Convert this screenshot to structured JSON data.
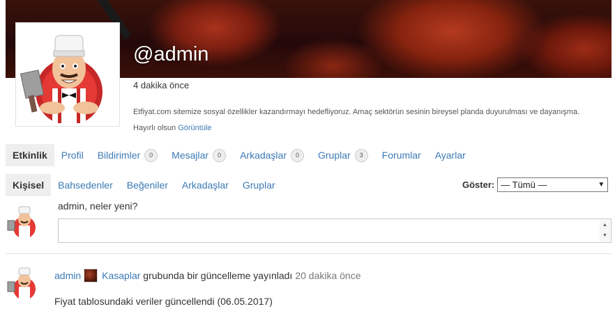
{
  "profile": {
    "username": "@admin",
    "last_active": "4 dakika önce",
    "bio_text": "Etfiyat.com sitemize sosyal özellikler kazandırmayı hedefliyoruz. Amaç sektörün sesinin bireysel planda duyurulması ve dayanışma. Hayırlı olsun",
    "bio_link": "Görüntüle"
  },
  "main_nav": [
    {
      "label": "Etkinlik",
      "count": null,
      "active": true
    },
    {
      "label": "Profil",
      "count": null
    },
    {
      "label": "Bildirimler",
      "count": "0"
    },
    {
      "label": "Mesajlar",
      "count": "0"
    },
    {
      "label": "Arkadaşlar",
      "count": "0"
    },
    {
      "label": "Gruplar",
      "count": "3"
    },
    {
      "label": "Forumlar",
      "count": null
    },
    {
      "label": "Ayarlar",
      "count": null
    }
  ],
  "sub_nav": [
    {
      "label": "Kişisel",
      "active": true
    },
    {
      "label": "Bahsedenler"
    },
    {
      "label": "Beğeniler"
    },
    {
      "label": "Arkadaşlar"
    },
    {
      "label": "Gruplar"
    }
  ],
  "filter": {
    "label": "Göster:",
    "selected": "— Tümü —"
  },
  "post_form": {
    "prompt": "admin, neler yeni?",
    "scroll_up": "▲",
    "scroll_down": "▼"
  },
  "activity": {
    "user": "admin",
    "group": "Kasaplar",
    "action": "grubunda bir güncelleme yayınladı",
    "time": "20 dakika önce",
    "content": "Fiyat tablosundaki veriler güncellendi (06.05.2017)"
  },
  "colors": {
    "link": "#3c7ab5",
    "active_tab_bg": "#eeeeee"
  }
}
